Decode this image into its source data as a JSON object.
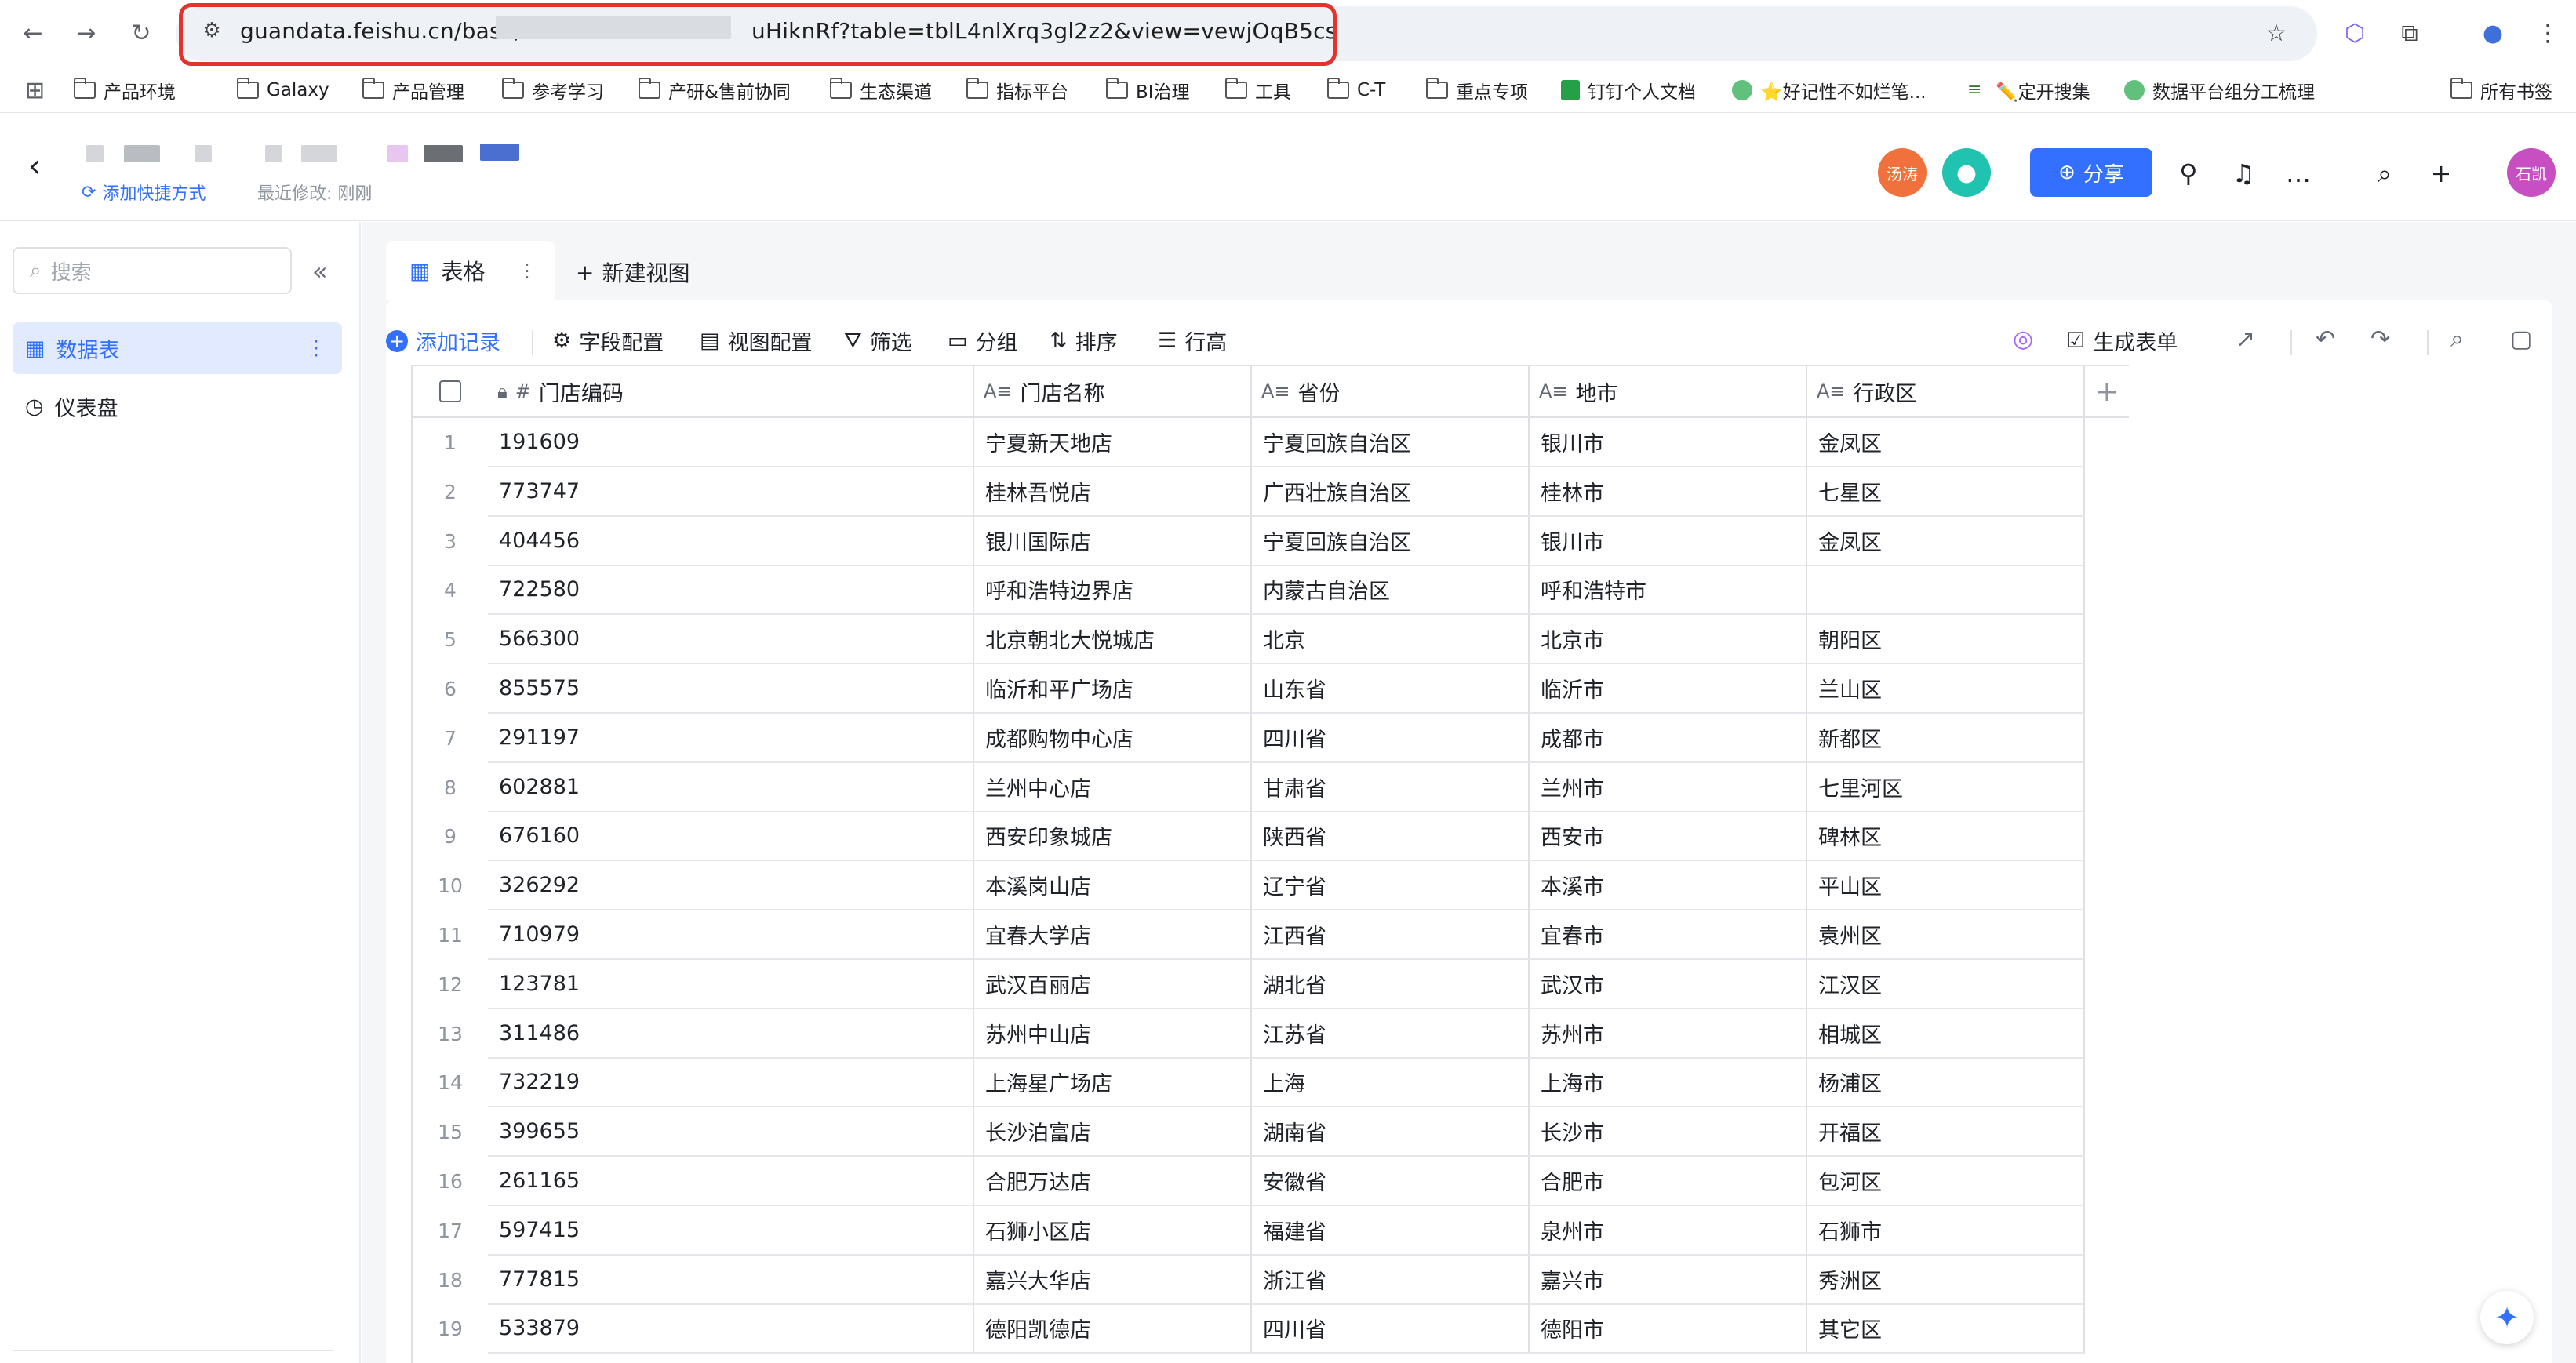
{
  "browser": {
    "url_prefix": "guandata.feishu.cn/base/",
    "url_suffix": "uHiknRf?table=tblL4nlXrq3gl2z2&view=vewjOqB5cs",
    "bookmarks": [
      {
        "label": "产品环境",
        "icon": "folder-icon"
      },
      {
        "label": "Galaxy",
        "icon": "folder-icon"
      },
      {
        "label": "产品管理",
        "icon": "folder-icon"
      },
      {
        "label": "参考学习",
        "icon": "folder-icon"
      },
      {
        "label": "产研&售前协同",
        "icon": "folder-icon"
      },
      {
        "label": "生态渠道",
        "icon": "folder-icon"
      },
      {
        "label": "指标平台",
        "icon": "folder-icon"
      },
      {
        "label": "BI治理",
        "icon": "folder-icon"
      },
      {
        "label": "工具",
        "icon": "folder-icon"
      },
      {
        "label": "C-T",
        "icon": "folder-icon"
      },
      {
        "label": "重点专项",
        "icon": "folder-icon"
      },
      {
        "label": "钉钉个人文档",
        "icon": "sheet-icon"
      },
      {
        "label": "⭐好记性不如烂笔...",
        "icon": "dot-icon"
      },
      {
        "label": "✏️定开搜集",
        "icon": "pen-icon"
      },
      {
        "label": "数据平台组分工梳理",
        "icon": "dot-icon"
      }
    ],
    "all_bookmarks": "所有书签"
  },
  "header": {
    "add_shortcut": "添加快捷方式",
    "last_modified": "最近修改: 刚刚",
    "avatar1": "汤涛",
    "avatar3": "石凯",
    "share_label": "分享"
  },
  "sidebar": {
    "search_placeholder": "搜索",
    "items": [
      {
        "label": "数据表",
        "active": true
      },
      {
        "label": "仪表盘",
        "active": false
      }
    ]
  },
  "view": {
    "tab_label": "表格",
    "new_view": "新建视图"
  },
  "toolbar": {
    "add_record": "添加记录",
    "field_config": "字段配置",
    "view_config": "视图配置",
    "filter": "筛选",
    "group": "分组",
    "sort": "排序",
    "row_height": "行高",
    "generate_form": "生成表单"
  },
  "table": {
    "columns": [
      "门店编码",
      "门店名称",
      "省份",
      "地市",
      "行政区"
    ],
    "rows": [
      {
        "n": "1",
        "c": [
          "191609",
          "宁夏新天地店",
          "宁夏回族自治区",
          "银川市",
          "金凤区"
        ]
      },
      {
        "n": "2",
        "c": [
          "773747",
          "桂林吾悦店",
          "广西壮族自治区",
          "桂林市",
          "七星区"
        ]
      },
      {
        "n": "3",
        "c": [
          "404456",
          "银川国际店",
          "宁夏回族自治区",
          "银川市",
          "金凤区"
        ]
      },
      {
        "n": "4",
        "c": [
          "722580",
          "呼和浩特边界店",
          "内蒙古自治区",
          "呼和浩特市",
          ""
        ]
      },
      {
        "n": "5",
        "c": [
          "566300",
          "北京朝北大悦城店",
          "北京",
          "北京市",
          "朝阳区"
        ]
      },
      {
        "n": "6",
        "c": [
          "855575",
          "临沂和平广场店",
          "山东省",
          "临沂市",
          "兰山区"
        ]
      },
      {
        "n": "7",
        "c": [
          "291197",
          "成都购物中心店",
          "四川省",
          "成都市",
          "新都区"
        ]
      },
      {
        "n": "8",
        "c": [
          "602881",
          "兰州中心店",
          "甘肃省",
          "兰州市",
          "七里河区"
        ]
      },
      {
        "n": "9",
        "c": [
          "676160",
          "西安印象城店",
          "陕西省",
          "西安市",
          "碑林区"
        ]
      },
      {
        "n": "10",
        "c": [
          "326292",
          "本溪岗山店",
          "辽宁省",
          "本溪市",
          "平山区"
        ]
      },
      {
        "n": "11",
        "c": [
          "710979",
          "宜春大学店",
          "江西省",
          "宜春市",
          "袁州区"
        ]
      },
      {
        "n": "12",
        "c": [
          "123781",
          "武汉百丽店",
          "湖北省",
          "武汉市",
          "江汉区"
        ]
      },
      {
        "n": "13",
        "c": [
          "311486",
          "苏州中山店",
          "江苏省",
          "苏州市",
          "相城区"
        ]
      },
      {
        "n": "14",
        "c": [
          "732219",
          "上海星广场店",
          "上海",
          "上海市",
          "杨浦区"
        ]
      },
      {
        "n": "15",
        "c": [
          "399655",
          "长沙泊富店",
          "湖南省",
          "长沙市",
          "开福区"
        ]
      },
      {
        "n": "16",
        "c": [
          "261165",
          "合肥万达店",
          "安徽省",
          "合肥市",
          "包河区"
        ]
      },
      {
        "n": "17",
        "c": [
          "597415",
          "石狮小区店",
          "福建省",
          "泉州市",
          "石狮市"
        ]
      },
      {
        "n": "18",
        "c": [
          "777815",
          "嘉兴大华店",
          "浙江省",
          "嘉兴市",
          "秀洲区"
        ]
      },
      {
        "n": "19",
        "c": [
          "533879",
          "德阳凯德店",
          "四川省",
          "德阳市",
          "其它区"
        ]
      }
    ]
  },
  "colors": {
    "accent": "#3370ff",
    "highlight": "#e5322d",
    "avatar1": "#f0713b",
    "avatar2": "#1fc3b0",
    "avatar3": "#c84fc2"
  }
}
